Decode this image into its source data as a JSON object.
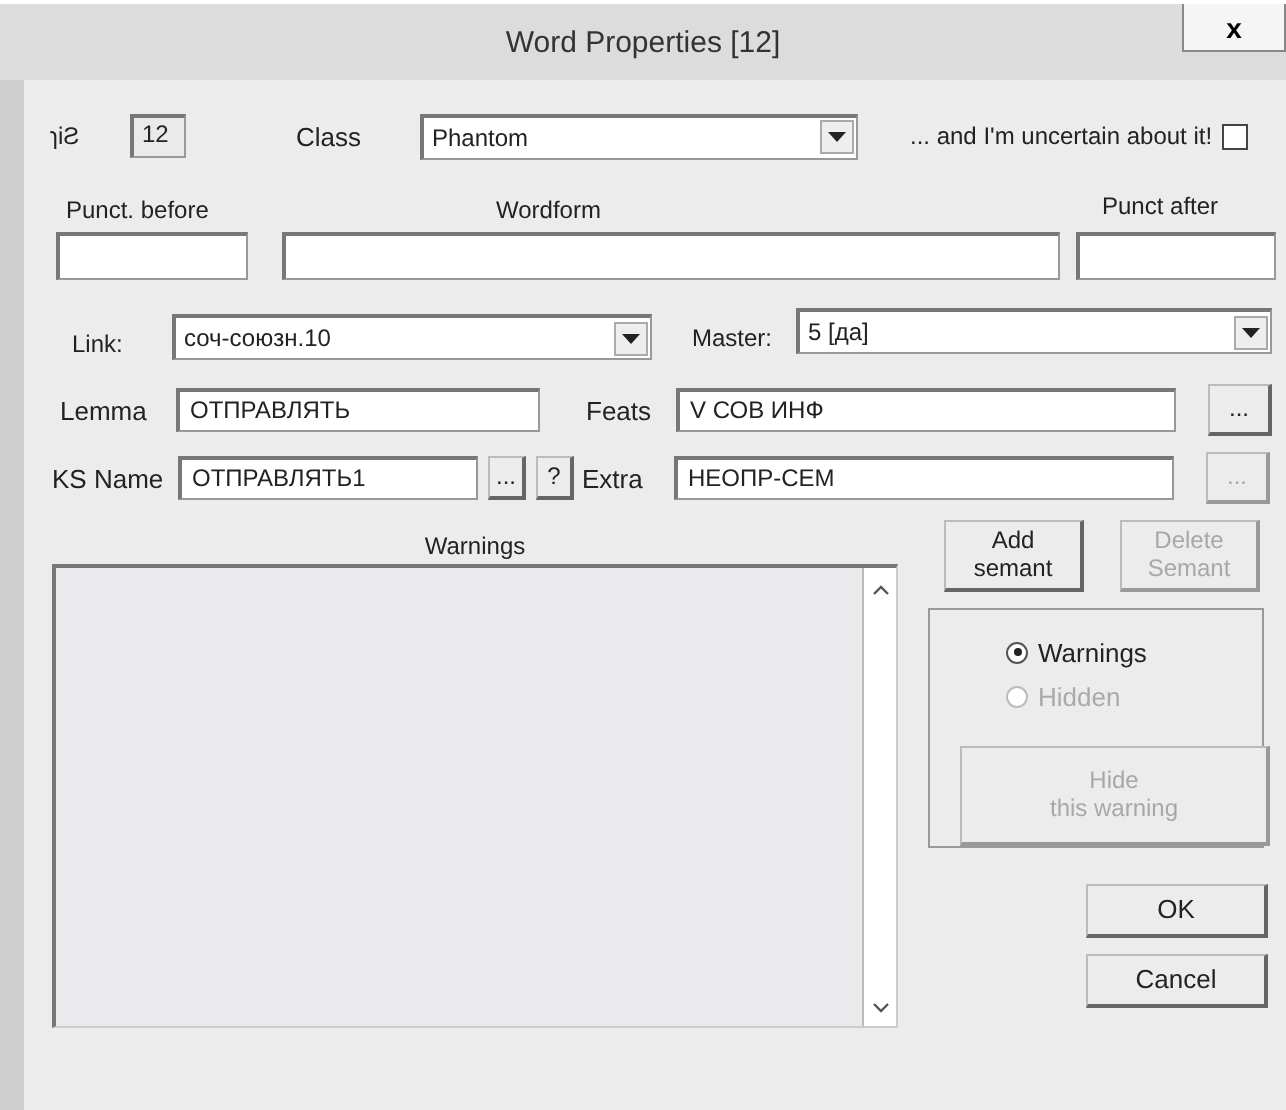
{
  "window": {
    "title": "Word Properties [12]",
    "close": "x"
  },
  "number": {
    "label": "ɿiƧ",
    "value": "12"
  },
  "word_class": {
    "label": "Class",
    "value": "Phantom"
  },
  "uncertain": {
    "label": "... and I'm uncertain about it!",
    "checked": false
  },
  "punct_before": {
    "label": "Punct. before"
  },
  "wordform": {
    "label": "Wordform"
  },
  "punct_after": {
    "label": "Punct after"
  },
  "link": {
    "label": "Link:",
    "value": "соч-союзн.10"
  },
  "master": {
    "label": "Master:",
    "value": "5 [да]"
  },
  "lemma": {
    "label": "Lemma",
    "value": "ОТПРАВЛЯТЬ"
  },
  "feats": {
    "label": "Feats",
    "value": "V СОВ ИНФ",
    "button": {
      "label": "...",
      "disabled": false
    }
  },
  "ks_name": {
    "label": "KS Name",
    "value": "ОТПРАВЛЯТЬ1",
    "buttons": [
      {
        "label": "...",
        "disabled": false
      },
      {
        "label": "?",
        "disabled": false
      }
    ]
  },
  "extra": {
    "label": "Extra",
    "value": "НЕОПР-СЕМ",
    "button": {
      "label": "...",
      "disabled": true
    }
  },
  "warnings_list": {
    "label": "Warnings"
  },
  "semant_buttons": [
    {
      "label": "Add\nsemant",
      "disabled": false
    },
    {
      "label": "Delete\nSemant",
      "disabled": true
    }
  ],
  "view_options": [
    {
      "label": "Warnings",
      "selected": true,
      "disabled": false
    },
    {
      "label": "Hidden",
      "selected": false,
      "disabled": true
    }
  ],
  "hide_button": {
    "label": "Hide\nthis warning",
    "disabled": true
  },
  "dialog_buttons": [
    "OK",
    "Cancel"
  ]
}
